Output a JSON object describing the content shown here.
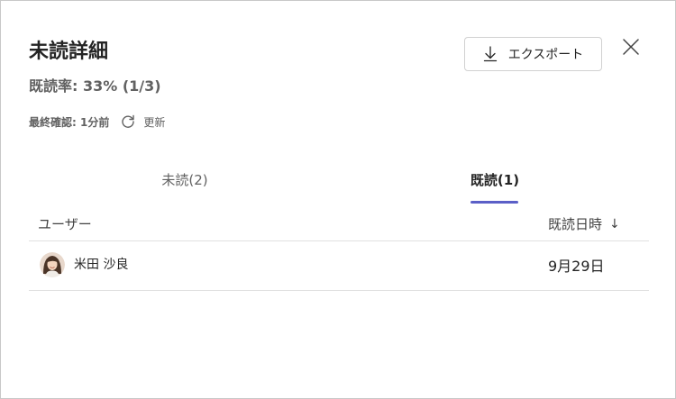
{
  "dialog": {
    "title": "未読詳細",
    "read_rate": "既読率: 33% (1/3)",
    "last_check_label": "最終確認: 1分前",
    "refresh_label": "更新",
    "export_label": "エクスポート"
  },
  "tabs": [
    {
      "label": "未読(2)",
      "selected": false
    },
    {
      "label": "既読(1)",
      "selected": true
    }
  ],
  "table": {
    "headers": {
      "user": "ユーザー",
      "read_datetime": "既読日時",
      "sort_indicator": "↓"
    },
    "rows": [
      {
        "user": "米田 沙良",
        "read_date": "9月29日",
        "avatar": "user-photo"
      }
    ]
  },
  "colors": {
    "accent": "#5b5fc7",
    "text_primary": "#242424",
    "text_secondary": "#616161",
    "divider": "#e0e0e0"
  },
  "icons": {
    "close": "close-icon",
    "export": "download-icon",
    "refresh": "refresh-icon"
  }
}
